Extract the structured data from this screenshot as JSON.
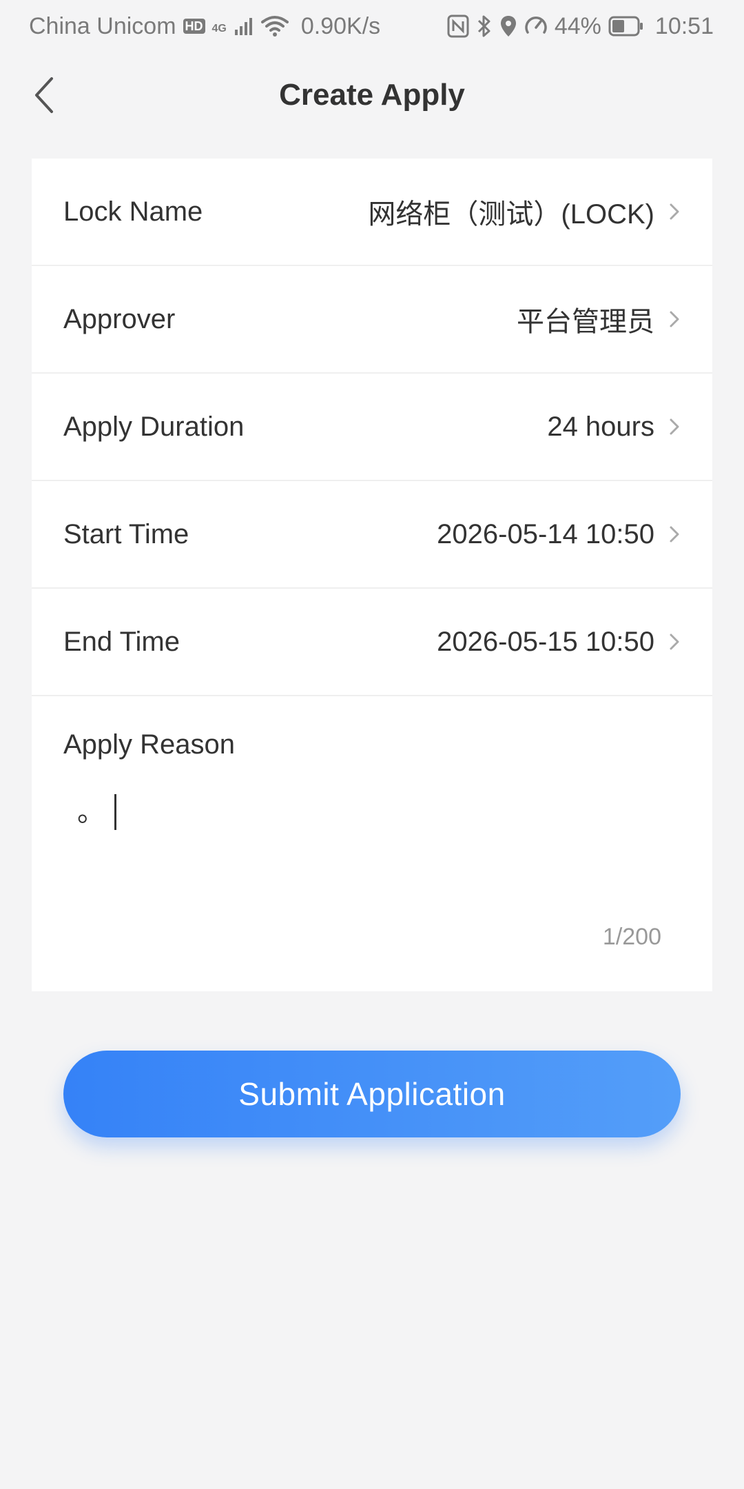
{
  "status_bar": {
    "carrier": "China Unicom",
    "hd_badge": "HD",
    "network_type": "4G",
    "speed": "0.90K/s",
    "battery": "44%",
    "time": "10:51",
    "icons": [
      "hd-icon",
      "signal-icon",
      "wifi-icon",
      "nfc-icon",
      "bluetooth-icon",
      "location-icon",
      "speedometer-icon",
      "battery-icon"
    ]
  },
  "header": {
    "title": "Create Apply",
    "back_icon": "back-arrow-icon"
  },
  "form": {
    "rows": [
      {
        "label": "Lock Name",
        "value": "网络柜（测试）(LOCK)"
      },
      {
        "label": "Approver",
        "value": "平台管理员"
      },
      {
        "label": "Apply Duration",
        "value": "24 hours"
      },
      {
        "label": "Start Time",
        "value": "2026-05-14 10:50"
      },
      {
        "label": "End Time",
        "value": "2026-05-15 10:50"
      }
    ],
    "reason": {
      "label": "Apply Reason",
      "value": "。",
      "count": "1/200"
    }
  },
  "submit": {
    "label": "Submit Application"
  },
  "colors": {
    "accent_start": "#3582f7",
    "accent_end": "#549ef9",
    "background": "#f4f4f5",
    "card": "#ffffff"
  }
}
